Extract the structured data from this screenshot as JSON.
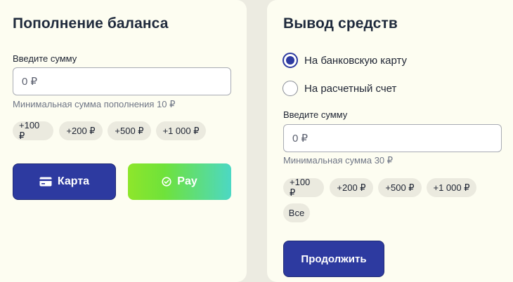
{
  "deposit": {
    "title": "Пополнение баланса",
    "amount_label": "Введите сумму",
    "amount_placeholder": "0 ₽",
    "min_hint": "Минимальная сумма пополнения 10 ₽",
    "chips": [
      "+100 ₽",
      "+200 ₽",
      "+500 ₽",
      "+1 000 ₽"
    ],
    "card_button": "Карта",
    "pay_button": "Pay"
  },
  "withdraw": {
    "title": "Вывод средств",
    "options": [
      {
        "label": "На банковскую карту",
        "checked": true
      },
      {
        "label": "На расчетный счет",
        "checked": false
      }
    ],
    "amount_label": "Введите сумму",
    "amount_placeholder": "0 ₽",
    "min_hint": "Минимальная сумма 30 ₽",
    "chips": [
      "+100 ₽",
      "+200 ₽",
      "+500 ₽",
      "+1 000 ₽"
    ],
    "all_chip": "Все",
    "continue_button": "Продолжить"
  }
}
